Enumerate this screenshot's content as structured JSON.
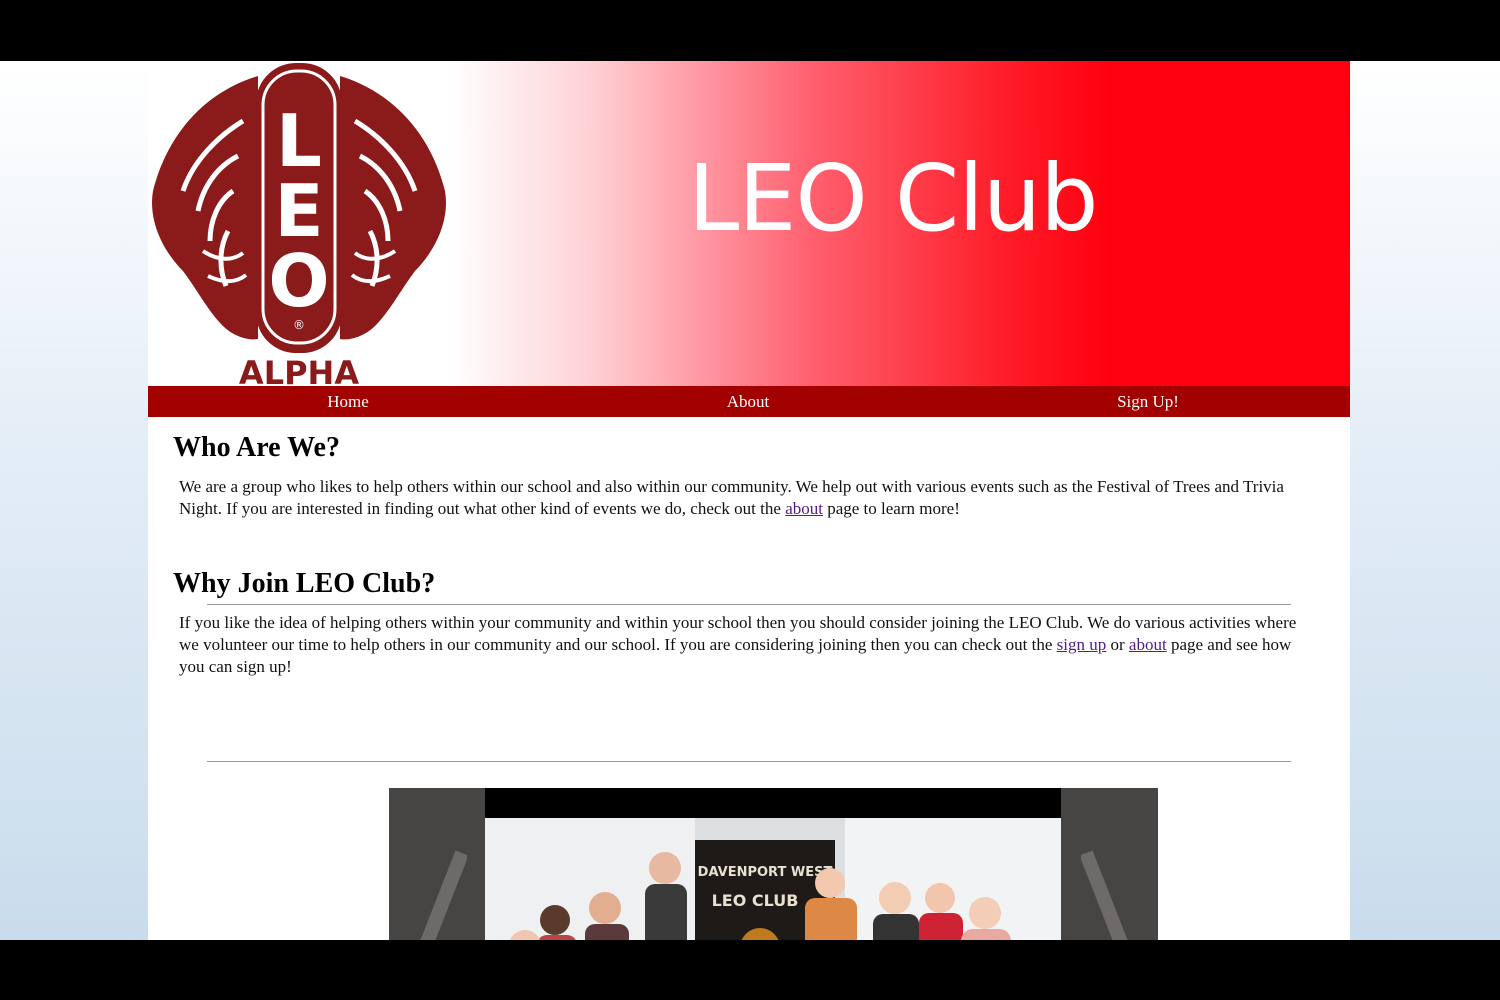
{
  "banner": {
    "title": "LEO Club",
    "logo_letters": [
      "L",
      "E",
      "O"
    ],
    "logo_caption": "ALPHA",
    "logo_mark": "®"
  },
  "nav": {
    "items": [
      {
        "label": "Home"
      },
      {
        "label": "About"
      },
      {
        "label": "Sign Up!"
      }
    ]
  },
  "sections": [
    {
      "heading": "Who Are We?",
      "text_before": "We are a group who likes to help others within our school and also within our community. We help out with various events such as the Festival of Trees and Trivia Night. If you are interested in finding out what other kind of events we do, check out the ",
      "link1": "about",
      "text_after": " page to learn more!"
    },
    {
      "heading": "Why Join LEO Club?",
      "text_before": "If you like the idea of helping others within your community and within your school then you should consider joining the LEO Club. We do various activities where we volunteer our time to help others in our community and our school. If you are considering joining then you can check out the ",
      "link1": "sign up",
      "text_mid": " or ",
      "link2": "about",
      "text_after": " page and see how you can sign up!"
    }
  ],
  "slider": {
    "banner_line1": "DAVENPORT WEST",
    "banner_line2": "LEO CLUB"
  },
  "colors": {
    "nav_bg": "#a30000",
    "banner_red": "#ff0010",
    "logo_red": "#8b1a1a",
    "link": "#551a8b"
  }
}
